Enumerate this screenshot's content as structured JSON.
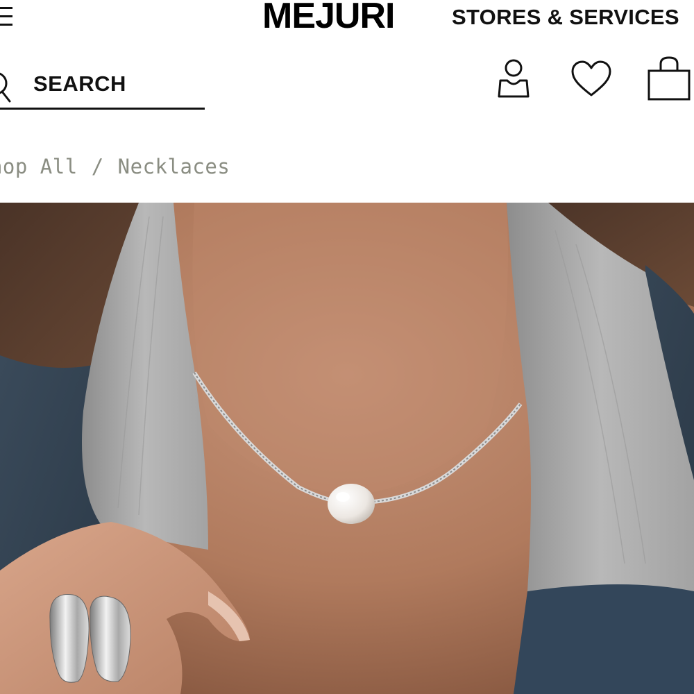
{
  "header": {
    "brand": "MEJURI",
    "stores_link": "STORES & SERVICES",
    "icons": {
      "menu": "menu-icon",
      "account": "account-icon",
      "wishlist": "heart-icon",
      "bag": "shopping-bag-icon"
    }
  },
  "search": {
    "label": "SEARCH",
    "icon": "search-icon"
  },
  "breadcrumb": {
    "items": [
      "Shop All",
      "Necklaces"
    ],
    "separator": "/",
    "color": "#8a8d82"
  },
  "hero": {
    "subject": "product-photo-pearl-necklace"
  },
  "colors": {
    "text": "#111111",
    "background": "#ffffff"
  }
}
